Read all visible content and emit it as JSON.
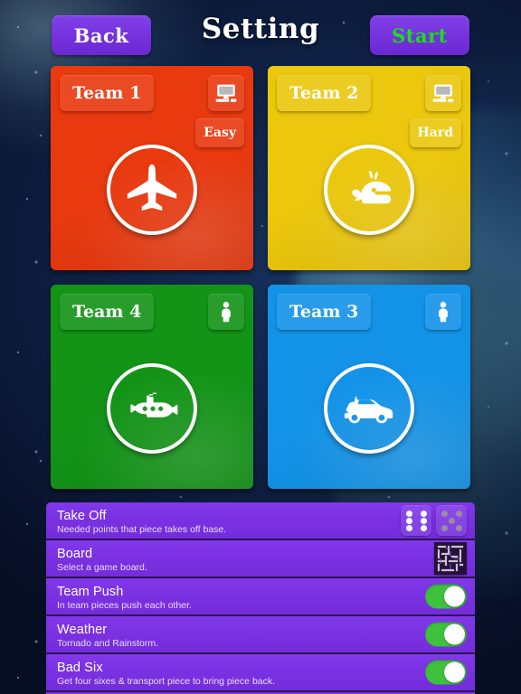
{
  "header": {
    "back_label": "Back",
    "title": "Setting",
    "start_label": "Start",
    "back_color": "#7531dd",
    "start_text_color": "#19e019"
  },
  "teams": [
    {
      "name": "Team 1",
      "color": "#e8390f",
      "vehicle_icon": "airplane-icon",
      "player_type": "computer",
      "player_type_icon": "computer-icon",
      "difficulty": "Easy"
    },
    {
      "name": "Team 2",
      "color": "#ebc70d",
      "vehicle_icon": "whale-icon",
      "player_type": "computer",
      "player_type_icon": "computer-icon",
      "difficulty": "Hard"
    },
    {
      "name": "Team 4",
      "color": "#139417",
      "vehicle_icon": "submarine-icon",
      "player_type": "human",
      "player_type_icon": "person-icon",
      "difficulty": null
    },
    {
      "name": "Team 3",
      "color": "#1393e8",
      "vehicle_icon": "car-icon",
      "player_type": "human",
      "player_type_icon": "person-icon",
      "difficulty": null
    }
  ],
  "settings": {
    "panel_color": "#7a31e1",
    "rows": [
      {
        "title": "Take Off",
        "desc": "Needed points that piece takes off base.",
        "control": "dice",
        "dice": [
          {
            "value": 6,
            "selected": true
          },
          {
            "value": 5,
            "selected": false
          }
        ]
      },
      {
        "title": "Board",
        "desc": "Select a game board.",
        "control": "board"
      },
      {
        "title": "Team Push",
        "desc": "In team pieces push each other.",
        "control": "toggle",
        "on": true
      },
      {
        "title": "Weather",
        "desc": "Tornado and Rainstorm.",
        "control": "toggle",
        "on": true
      },
      {
        "title": "Bad Six",
        "desc": "Get four sixes & transport piece to bring piece back.",
        "control": "toggle",
        "on": true
      }
    ]
  }
}
